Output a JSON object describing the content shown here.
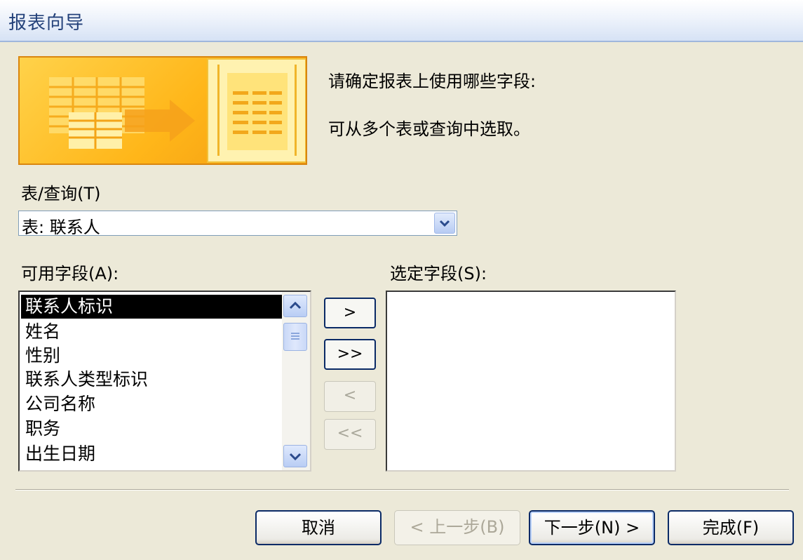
{
  "window": {
    "title": "报表向导"
  },
  "intro": {
    "line1": "请确定报表上使用哪些字段:",
    "line2": "可从多个表或查询中选取。"
  },
  "table_query": {
    "label": "表/查询(T)",
    "selected": "表: 联系人"
  },
  "available_fields": {
    "label": "可用字段(A):",
    "items": [
      "联系人标识",
      "姓名",
      "性别",
      "联系人类型标识",
      "公司名称",
      "职务",
      "出生日期"
    ],
    "selected_index": 0
  },
  "selected_fields": {
    "label": "选定字段(S):",
    "items": []
  },
  "move_buttons": {
    "add_one": ">",
    "add_all": ">>",
    "remove_one": "<",
    "remove_all": "<<"
  },
  "footer": {
    "cancel": "取消",
    "back": "< 上一步(B)",
    "next": "下一步(N) >",
    "finish": "完成(F)"
  },
  "colors": {
    "title_text": "#23417a",
    "banner_orange": "#ffb619",
    "button_border": "#0a2a66",
    "selection": "#000000"
  }
}
